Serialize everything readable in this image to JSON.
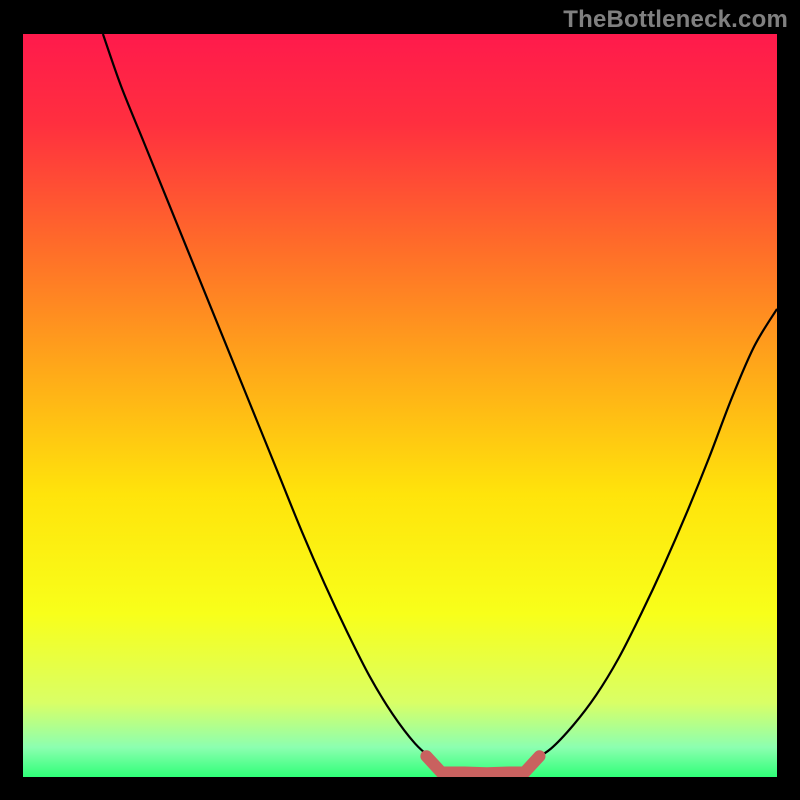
{
  "source_label": "TheBottleneck.com",
  "colors": {
    "black": "#000000",
    "label_gray": "#808080",
    "curve_black": "#000000",
    "bracket": "#c9615f"
  },
  "chart_data": {
    "type": "line",
    "title": "",
    "xlabel": "",
    "ylabel": "",
    "xlim": [
      0,
      100
    ],
    "ylim": [
      0,
      100
    ],
    "grid": false,
    "legend": false,
    "gradient_stops": [
      {
        "offset": 0,
        "color": "#ff1a4c"
      },
      {
        "offset": 0.12,
        "color": "#ff2f3f"
      },
      {
        "offset": 0.28,
        "color": "#ff6a2a"
      },
      {
        "offset": 0.45,
        "color": "#ffa819"
      },
      {
        "offset": 0.62,
        "color": "#ffe40b"
      },
      {
        "offset": 0.78,
        "color": "#f8ff1a"
      },
      {
        "offset": 0.9,
        "color": "#d9ff66"
      },
      {
        "offset": 0.96,
        "color": "#8cffb0"
      },
      {
        "offset": 1.0,
        "color": "#2fff78"
      }
    ],
    "series": [
      {
        "name": "bottleneck-curve-left",
        "x": [
          10.6,
          13,
          16,
          19,
          22,
          25,
          28,
          31,
          34,
          37,
          40,
          43,
          46,
          49,
          52,
          54.5
        ],
        "y": [
          100,
          93,
          85.5,
          78,
          70.5,
          63,
          55.5,
          48,
          40.5,
          33,
          26,
          19.5,
          13.5,
          8.5,
          4.5,
          2.2
        ]
      },
      {
        "name": "bottleneck-curve-right",
        "x": [
          67.5,
          70,
          73,
          76,
          79,
          82,
          85,
          88,
          91,
          94,
          97,
          100
        ],
        "y": [
          2.2,
          3.8,
          7,
          11,
          16,
          22,
          28.5,
          35.5,
          43,
          51,
          58,
          63
        ]
      },
      {
        "name": "floor-bracket",
        "x": [
          53.5,
          55.5,
          58.5,
          61.5,
          64.5,
          66.5,
          68.5
        ],
        "y": [
          2.8,
          0.6,
          0.6,
          0.5,
          0.6,
          0.6,
          2.8
        ]
      }
    ]
  }
}
